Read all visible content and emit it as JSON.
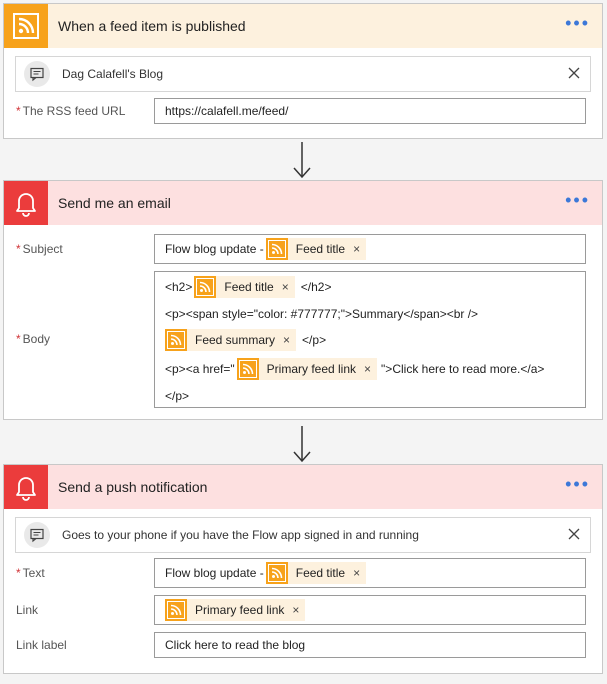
{
  "trigger": {
    "title": "When a feed item is published",
    "info_text": "Dag Calafell's Blog",
    "fields": [
      {
        "label": "The RSS feed URL",
        "required": "*",
        "value": "https://calafell.me/feed/"
      }
    ]
  },
  "email": {
    "title": "Send me an email",
    "subject_label": "Subject",
    "subject_prefix": "Flow blog update -",
    "subject_token": "Feed title",
    "body_label": "Body",
    "required": "*",
    "body": {
      "l1_pre": "<h2>",
      "l1_token": "Feed title",
      "l1_post": "</h2>",
      "l2": "<p><span style=\"color: #777777;\">Summary</span><br />",
      "l3_token": "Feed summary",
      "l3_post": "</p>",
      "l4_pre": "<p><a href=\"",
      "l4_token": "Primary feed link",
      "l4_post": "\">Click here to read more.</a>",
      "l5": "</p>"
    }
  },
  "push": {
    "title": "Send a push notification",
    "info_text": "Goes to your phone if you have the Flow app signed in and running",
    "text_label": "Text",
    "required": "*",
    "text_prefix": "Flow blog update -",
    "text_token": "Feed title",
    "link_label": "Link",
    "link_token": "Primary feed link",
    "link_label_label": "Link label",
    "link_label_value": "Click here to read the blog"
  },
  "ui": {
    "more": "•••",
    "token_remove": "×",
    "accent": "#3c78d8",
    "rss_color": "#f7a21b",
    "alert_color": "#eb3c3c"
  }
}
